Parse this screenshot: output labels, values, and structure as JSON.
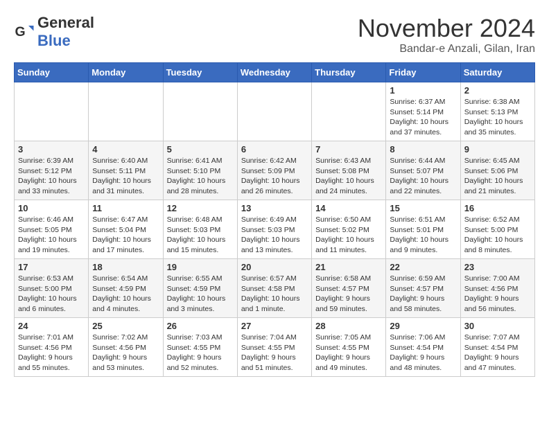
{
  "header": {
    "logo_general": "General",
    "logo_blue": "Blue",
    "month_title": "November 2024",
    "location": "Bandar-e Anzali, Gilan, Iran"
  },
  "weekdays": [
    "Sunday",
    "Monday",
    "Tuesday",
    "Wednesday",
    "Thursday",
    "Friday",
    "Saturday"
  ],
  "weeks": [
    [
      {
        "day": "",
        "info": ""
      },
      {
        "day": "",
        "info": ""
      },
      {
        "day": "",
        "info": ""
      },
      {
        "day": "",
        "info": ""
      },
      {
        "day": "",
        "info": ""
      },
      {
        "day": "1",
        "info": "Sunrise: 6:37 AM\nSunset: 5:14 PM\nDaylight: 10 hours and 37 minutes."
      },
      {
        "day": "2",
        "info": "Sunrise: 6:38 AM\nSunset: 5:13 PM\nDaylight: 10 hours and 35 minutes."
      }
    ],
    [
      {
        "day": "3",
        "info": "Sunrise: 6:39 AM\nSunset: 5:12 PM\nDaylight: 10 hours and 33 minutes."
      },
      {
        "day": "4",
        "info": "Sunrise: 6:40 AM\nSunset: 5:11 PM\nDaylight: 10 hours and 31 minutes."
      },
      {
        "day": "5",
        "info": "Sunrise: 6:41 AM\nSunset: 5:10 PM\nDaylight: 10 hours and 28 minutes."
      },
      {
        "day": "6",
        "info": "Sunrise: 6:42 AM\nSunset: 5:09 PM\nDaylight: 10 hours and 26 minutes."
      },
      {
        "day": "7",
        "info": "Sunrise: 6:43 AM\nSunset: 5:08 PM\nDaylight: 10 hours and 24 minutes."
      },
      {
        "day": "8",
        "info": "Sunrise: 6:44 AM\nSunset: 5:07 PM\nDaylight: 10 hours and 22 minutes."
      },
      {
        "day": "9",
        "info": "Sunrise: 6:45 AM\nSunset: 5:06 PM\nDaylight: 10 hours and 21 minutes."
      }
    ],
    [
      {
        "day": "10",
        "info": "Sunrise: 6:46 AM\nSunset: 5:05 PM\nDaylight: 10 hours and 19 minutes."
      },
      {
        "day": "11",
        "info": "Sunrise: 6:47 AM\nSunset: 5:04 PM\nDaylight: 10 hours and 17 minutes."
      },
      {
        "day": "12",
        "info": "Sunrise: 6:48 AM\nSunset: 5:03 PM\nDaylight: 10 hours and 15 minutes."
      },
      {
        "day": "13",
        "info": "Sunrise: 6:49 AM\nSunset: 5:03 PM\nDaylight: 10 hours and 13 minutes."
      },
      {
        "day": "14",
        "info": "Sunrise: 6:50 AM\nSunset: 5:02 PM\nDaylight: 10 hours and 11 minutes."
      },
      {
        "day": "15",
        "info": "Sunrise: 6:51 AM\nSunset: 5:01 PM\nDaylight: 10 hours and 9 minutes."
      },
      {
        "day": "16",
        "info": "Sunrise: 6:52 AM\nSunset: 5:00 PM\nDaylight: 10 hours and 8 minutes."
      }
    ],
    [
      {
        "day": "17",
        "info": "Sunrise: 6:53 AM\nSunset: 5:00 PM\nDaylight: 10 hours and 6 minutes."
      },
      {
        "day": "18",
        "info": "Sunrise: 6:54 AM\nSunset: 4:59 PM\nDaylight: 10 hours and 4 minutes."
      },
      {
        "day": "19",
        "info": "Sunrise: 6:55 AM\nSunset: 4:59 PM\nDaylight: 10 hours and 3 minutes."
      },
      {
        "day": "20",
        "info": "Sunrise: 6:57 AM\nSunset: 4:58 PM\nDaylight: 10 hours and 1 minute."
      },
      {
        "day": "21",
        "info": "Sunrise: 6:58 AM\nSunset: 4:57 PM\nDaylight: 9 hours and 59 minutes."
      },
      {
        "day": "22",
        "info": "Sunrise: 6:59 AM\nSunset: 4:57 PM\nDaylight: 9 hours and 58 minutes."
      },
      {
        "day": "23",
        "info": "Sunrise: 7:00 AM\nSunset: 4:56 PM\nDaylight: 9 hours and 56 minutes."
      }
    ],
    [
      {
        "day": "24",
        "info": "Sunrise: 7:01 AM\nSunset: 4:56 PM\nDaylight: 9 hours and 55 minutes."
      },
      {
        "day": "25",
        "info": "Sunrise: 7:02 AM\nSunset: 4:56 PM\nDaylight: 9 hours and 53 minutes."
      },
      {
        "day": "26",
        "info": "Sunrise: 7:03 AM\nSunset: 4:55 PM\nDaylight: 9 hours and 52 minutes."
      },
      {
        "day": "27",
        "info": "Sunrise: 7:04 AM\nSunset: 4:55 PM\nDaylight: 9 hours and 51 minutes."
      },
      {
        "day": "28",
        "info": "Sunrise: 7:05 AM\nSunset: 4:55 PM\nDaylight: 9 hours and 49 minutes."
      },
      {
        "day": "29",
        "info": "Sunrise: 7:06 AM\nSunset: 4:54 PM\nDaylight: 9 hours and 48 minutes."
      },
      {
        "day": "30",
        "info": "Sunrise: 7:07 AM\nSunset: 4:54 PM\nDaylight: 9 hours and 47 minutes."
      }
    ]
  ]
}
